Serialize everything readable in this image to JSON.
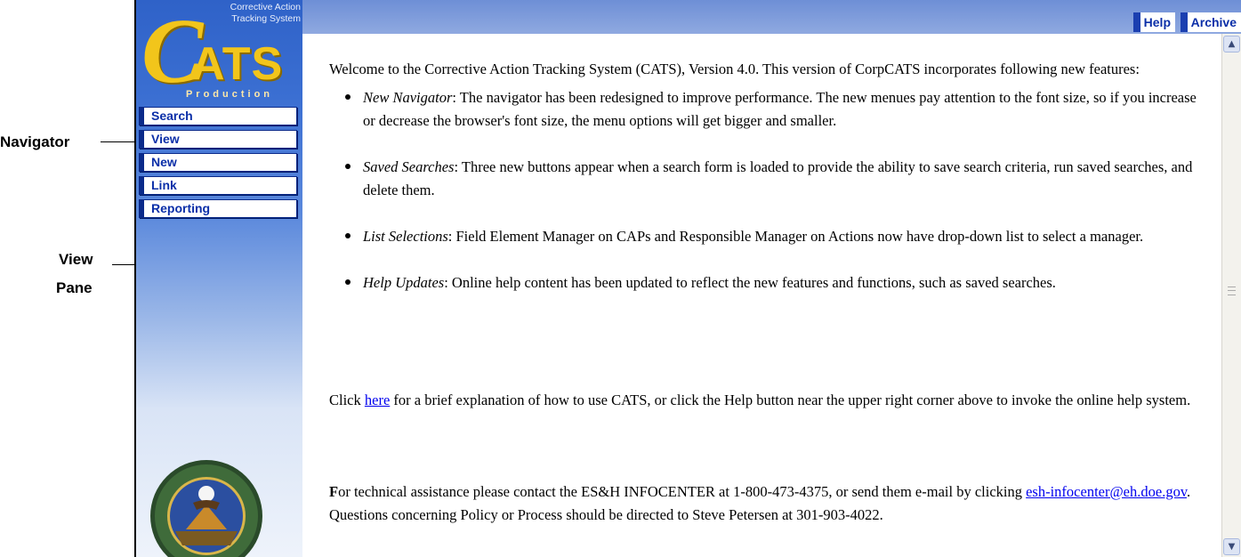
{
  "annotations": {
    "navigator": "Navigator",
    "view_pane_line1": "View",
    "view_pane_line2": "Pane"
  },
  "logo": {
    "subtitle_line1": "Corrective Action",
    "subtitle_line2": "Tracking System",
    "letter_c": "C",
    "letters_ats": "ATS",
    "environment": "Production"
  },
  "sidebar": {
    "items": [
      {
        "label": "Search"
      },
      {
        "label": "View"
      },
      {
        "label": "New"
      },
      {
        "label": "Link"
      },
      {
        "label": "Reporting"
      }
    ]
  },
  "header": {
    "help_label": "Help",
    "archive_label": "Archive"
  },
  "content": {
    "intro": "Welcome to the Corrective Action Tracking System (CATS), Version 4.0. This version of CorpCATS incorporates following new features:",
    "features": [
      {
        "name": "New Navigator",
        "text": ":  The navigator has been redesigned to improve performance. The new menues pay attention to the font size, so if you increase or decrease the browser's font size, the menu options will get bigger and smaller."
      },
      {
        "name": "Saved Searches",
        "text": ":  Three new buttons appear when a search form is loaded to provide the ability to save search criteria, run saved searches, and delete them."
      },
      {
        "name": "List Selections",
        "text": ":  Field Element Manager on CAPs and Responsible Manager on Actions now have drop-down list to select a manager."
      },
      {
        "name": "Help Updates",
        "text": ":  Online help content has been updated to reflect the new features and functions, such as saved searches."
      }
    ],
    "click_prefix": "Click ",
    "here_link": "here",
    "click_suffix": " for a brief explanation of how to use CATS, or click the Help button near the upper right corner above to invoke the online help system.",
    "tech_dropcap": "F",
    "tech_prefix": "or technical assistance please contact the ES&H INFOCENTER at 1-800-473-4375, or send them e-mail by clicking ",
    "email_link": "esh-infocenter@eh.doe.gov",
    "tech_suffix": ". Questions concerning Policy or Process should be directed to Steve Petersen at 301-903-4022."
  },
  "scrollbar": {
    "up_icon": "chevron-up-icon",
    "down_icon": "chevron-down-icon"
  },
  "colors": {
    "sidebar_blue": "#2f62c8",
    "logo_gold": "#f2c51b",
    "nav_text": "#0b2fa8",
    "link": "#0000ee"
  }
}
